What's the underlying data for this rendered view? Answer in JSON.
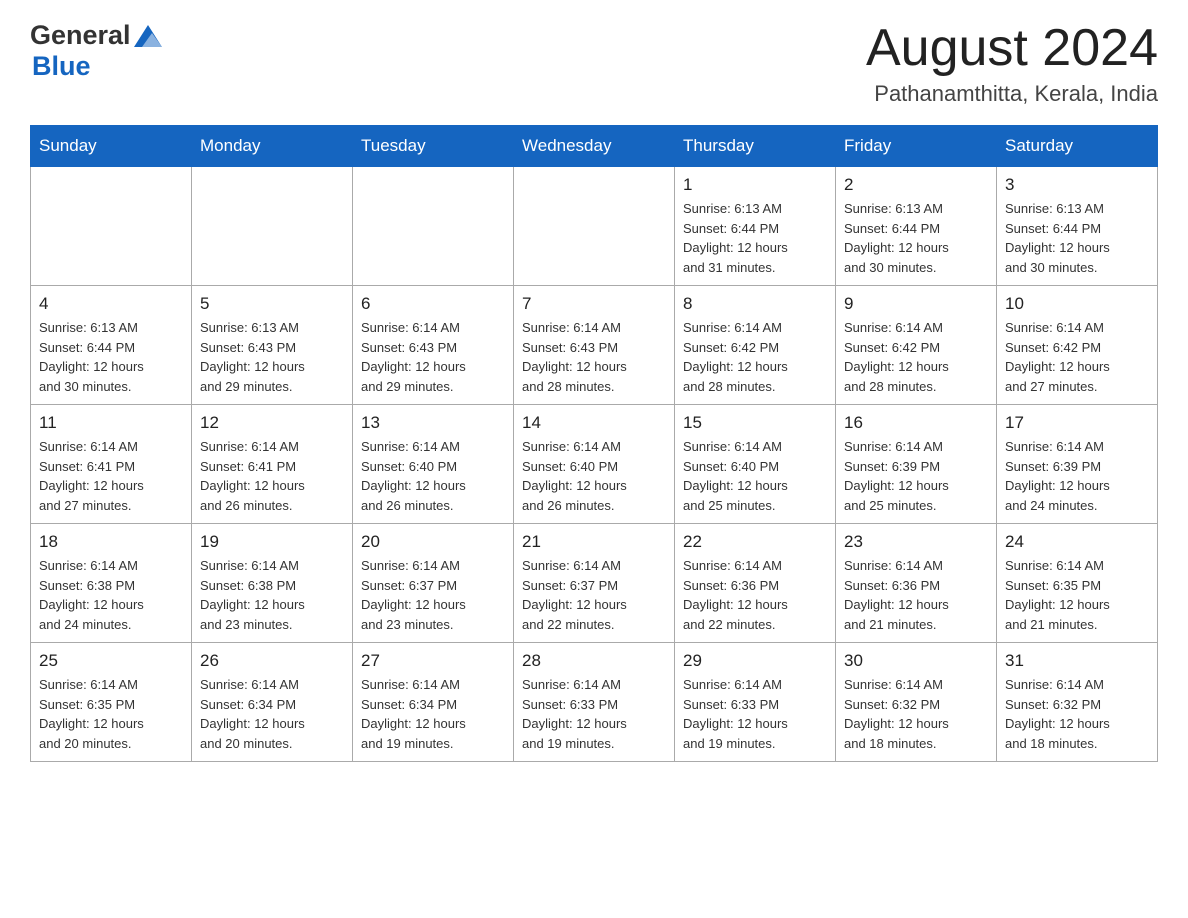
{
  "header": {
    "logo_general": "General",
    "logo_blue": "Blue",
    "month_year": "August 2024",
    "location": "Pathanamthitta, Kerala, India"
  },
  "weekdays": [
    "Sunday",
    "Monday",
    "Tuesday",
    "Wednesday",
    "Thursday",
    "Friday",
    "Saturday"
  ],
  "weeks": [
    [
      {
        "day": "",
        "info": ""
      },
      {
        "day": "",
        "info": ""
      },
      {
        "day": "",
        "info": ""
      },
      {
        "day": "",
        "info": ""
      },
      {
        "day": "1",
        "info": "Sunrise: 6:13 AM\nSunset: 6:44 PM\nDaylight: 12 hours\nand 31 minutes."
      },
      {
        "day": "2",
        "info": "Sunrise: 6:13 AM\nSunset: 6:44 PM\nDaylight: 12 hours\nand 30 minutes."
      },
      {
        "day": "3",
        "info": "Sunrise: 6:13 AM\nSunset: 6:44 PM\nDaylight: 12 hours\nand 30 minutes."
      }
    ],
    [
      {
        "day": "4",
        "info": "Sunrise: 6:13 AM\nSunset: 6:44 PM\nDaylight: 12 hours\nand 30 minutes."
      },
      {
        "day": "5",
        "info": "Sunrise: 6:13 AM\nSunset: 6:43 PM\nDaylight: 12 hours\nand 29 minutes."
      },
      {
        "day": "6",
        "info": "Sunrise: 6:14 AM\nSunset: 6:43 PM\nDaylight: 12 hours\nand 29 minutes."
      },
      {
        "day": "7",
        "info": "Sunrise: 6:14 AM\nSunset: 6:43 PM\nDaylight: 12 hours\nand 28 minutes."
      },
      {
        "day": "8",
        "info": "Sunrise: 6:14 AM\nSunset: 6:42 PM\nDaylight: 12 hours\nand 28 minutes."
      },
      {
        "day": "9",
        "info": "Sunrise: 6:14 AM\nSunset: 6:42 PM\nDaylight: 12 hours\nand 28 minutes."
      },
      {
        "day": "10",
        "info": "Sunrise: 6:14 AM\nSunset: 6:42 PM\nDaylight: 12 hours\nand 27 minutes."
      }
    ],
    [
      {
        "day": "11",
        "info": "Sunrise: 6:14 AM\nSunset: 6:41 PM\nDaylight: 12 hours\nand 27 minutes."
      },
      {
        "day": "12",
        "info": "Sunrise: 6:14 AM\nSunset: 6:41 PM\nDaylight: 12 hours\nand 26 minutes."
      },
      {
        "day": "13",
        "info": "Sunrise: 6:14 AM\nSunset: 6:40 PM\nDaylight: 12 hours\nand 26 minutes."
      },
      {
        "day": "14",
        "info": "Sunrise: 6:14 AM\nSunset: 6:40 PM\nDaylight: 12 hours\nand 26 minutes."
      },
      {
        "day": "15",
        "info": "Sunrise: 6:14 AM\nSunset: 6:40 PM\nDaylight: 12 hours\nand 25 minutes."
      },
      {
        "day": "16",
        "info": "Sunrise: 6:14 AM\nSunset: 6:39 PM\nDaylight: 12 hours\nand 25 minutes."
      },
      {
        "day": "17",
        "info": "Sunrise: 6:14 AM\nSunset: 6:39 PM\nDaylight: 12 hours\nand 24 minutes."
      }
    ],
    [
      {
        "day": "18",
        "info": "Sunrise: 6:14 AM\nSunset: 6:38 PM\nDaylight: 12 hours\nand 24 minutes."
      },
      {
        "day": "19",
        "info": "Sunrise: 6:14 AM\nSunset: 6:38 PM\nDaylight: 12 hours\nand 23 minutes."
      },
      {
        "day": "20",
        "info": "Sunrise: 6:14 AM\nSunset: 6:37 PM\nDaylight: 12 hours\nand 23 minutes."
      },
      {
        "day": "21",
        "info": "Sunrise: 6:14 AM\nSunset: 6:37 PM\nDaylight: 12 hours\nand 22 minutes."
      },
      {
        "day": "22",
        "info": "Sunrise: 6:14 AM\nSunset: 6:36 PM\nDaylight: 12 hours\nand 22 minutes."
      },
      {
        "day": "23",
        "info": "Sunrise: 6:14 AM\nSunset: 6:36 PM\nDaylight: 12 hours\nand 21 minutes."
      },
      {
        "day": "24",
        "info": "Sunrise: 6:14 AM\nSunset: 6:35 PM\nDaylight: 12 hours\nand 21 minutes."
      }
    ],
    [
      {
        "day": "25",
        "info": "Sunrise: 6:14 AM\nSunset: 6:35 PM\nDaylight: 12 hours\nand 20 minutes."
      },
      {
        "day": "26",
        "info": "Sunrise: 6:14 AM\nSunset: 6:34 PM\nDaylight: 12 hours\nand 20 minutes."
      },
      {
        "day": "27",
        "info": "Sunrise: 6:14 AM\nSunset: 6:34 PM\nDaylight: 12 hours\nand 19 minutes."
      },
      {
        "day": "28",
        "info": "Sunrise: 6:14 AM\nSunset: 6:33 PM\nDaylight: 12 hours\nand 19 minutes."
      },
      {
        "day": "29",
        "info": "Sunrise: 6:14 AM\nSunset: 6:33 PM\nDaylight: 12 hours\nand 19 minutes."
      },
      {
        "day": "30",
        "info": "Sunrise: 6:14 AM\nSunset: 6:32 PM\nDaylight: 12 hours\nand 18 minutes."
      },
      {
        "day": "31",
        "info": "Sunrise: 6:14 AM\nSunset: 6:32 PM\nDaylight: 12 hours\nand 18 minutes."
      }
    ]
  ]
}
